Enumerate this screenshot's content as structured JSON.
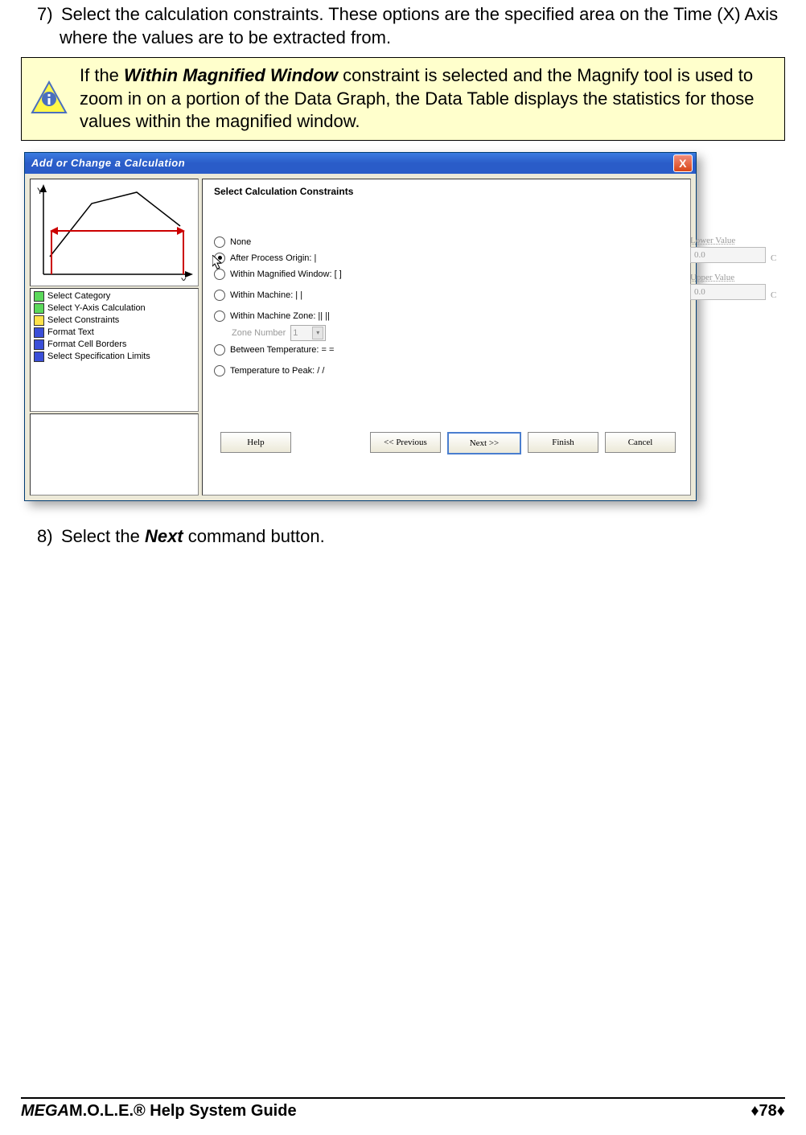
{
  "step7": {
    "num": "7)",
    "text_a": "Select the calculation constraints. These options are the specified area on the Time (X) Axis where the values are to be extracted from."
  },
  "note": {
    "prefix": "If the ",
    "bold": "Within Magnified Window",
    "rest": " constraint is selected and the Magnify tool is used to zoom in on a portion of the Data Graph, the Data Table displays the statistics for those values within the magnified window."
  },
  "dialog": {
    "title": "Add or Change a Calculation",
    "close": "X",
    "steps": [
      {
        "color": "green",
        "label": "Select Category"
      },
      {
        "color": "green",
        "label": "Select Y-Axis Calculation"
      },
      {
        "color": "yellow",
        "label": "Select Constraints"
      },
      {
        "color": "blue",
        "label": "Format Text"
      },
      {
        "color": "blue",
        "label": "Format Cell Borders"
      },
      {
        "color": "blue",
        "label": "Select Specification Limits"
      }
    ],
    "heading": "Select Calculation Constraints",
    "radios": {
      "none": "None",
      "after": "After Process Origin: |",
      "magnified": "Within Magnified Window: [  ]",
      "machine": "Within Machine: |  |",
      "zone": "Within Machine Zone: ||  ||",
      "zone_label": "Zone Number",
      "zone_val": "1",
      "between": "Between Temperature: =  =",
      "peak": "Temperature to Peak: /  /"
    },
    "lower": {
      "label": "Lower Value",
      "val": "0.0",
      "unit": "C"
    },
    "upper": {
      "label": "Upper Value",
      "val": "0.0",
      "unit": "C"
    },
    "buttons": {
      "help": "Help",
      "prev": "<< Previous",
      "next": "Next >>",
      "finish": "Finish",
      "cancel": "Cancel"
    }
  },
  "step8": {
    "num": "8)",
    "prefix": "Select the ",
    "bold": "Next",
    "suffix": " command button."
  },
  "footer": {
    "prefix_bold": "MEGA",
    "prefix_rest": "M.O.L.E.® Help System Guide",
    "page": "78",
    "diamond": "♦"
  }
}
